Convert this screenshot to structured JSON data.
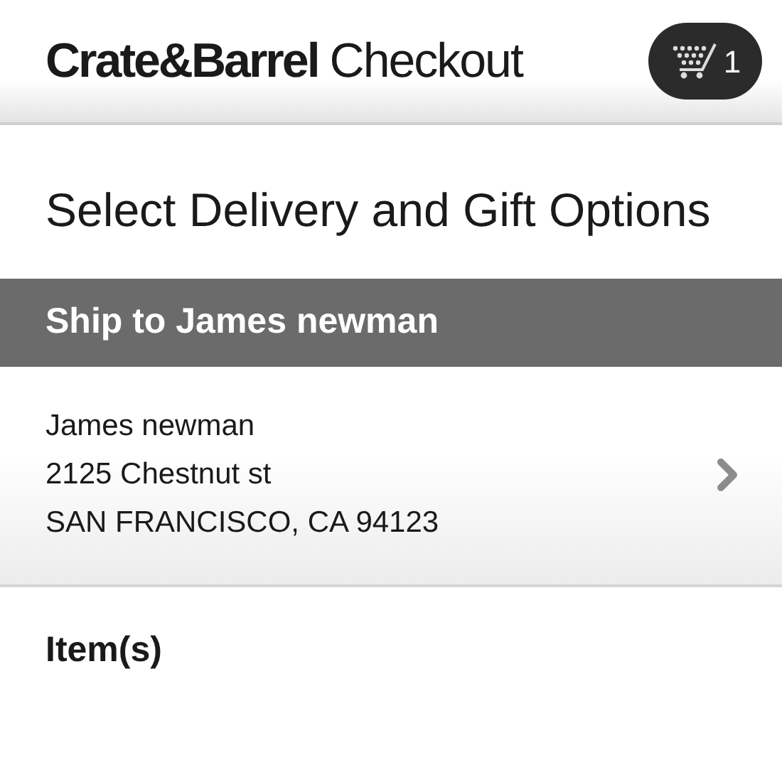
{
  "header": {
    "brand": "Crate&Barrel",
    "title": "Checkout",
    "cart_count": "1"
  },
  "page_title": "Select Delivery and Gift Options",
  "ship_to": "Ship to James newman",
  "address": {
    "lines": [
      "James newman",
      "2125 Chestnut st",
      "SAN FRANCISCO, CA 94123"
    ]
  },
  "items_heading": "Item(s)"
}
